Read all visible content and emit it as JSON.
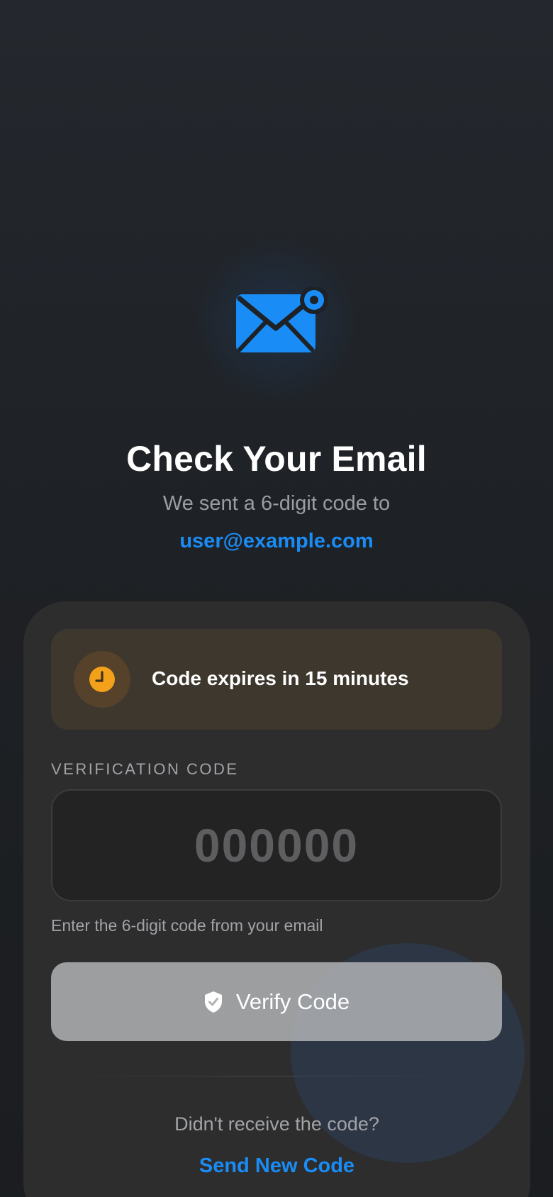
{
  "colors": {
    "accent": "#1a8cf5",
    "warning": "#f3a01a",
    "background": "#1e2125",
    "card": "#2d2d2e"
  },
  "header": {
    "icon": "email-notification-icon",
    "title": "Check Your Email",
    "subtitle": "We sent a 6-digit code to",
    "email": "user@example.com"
  },
  "expiry_notice": {
    "icon": "clock-icon",
    "text": "Code expires in 15 minutes"
  },
  "code_field": {
    "label": "VERIFICATION CODE",
    "value": "",
    "placeholder": "000000",
    "hint": "Enter the 6-digit code from your email"
  },
  "verify_button": {
    "icon": "shield-check-icon",
    "label": "Verify Code",
    "enabled": false
  },
  "resend": {
    "prompt": "Didn't receive the code?",
    "link_label": "Send New Code"
  }
}
